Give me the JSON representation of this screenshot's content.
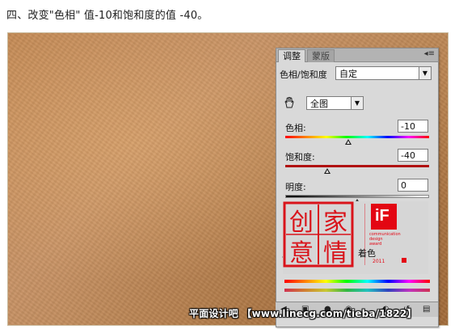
{
  "caption": "四、改变\"色相\" 值-10和饱和度的值 -40。",
  "panel": {
    "tabs": [
      {
        "label": "调整",
        "active": true
      },
      {
        "label": "蒙版",
        "active": false
      }
    ],
    "menu_icon": "panel-menu-icon",
    "title": "色相/饱和度",
    "preset": "自定",
    "channel": "全图",
    "hue_label": "色相:",
    "hue_value": "-10",
    "saturation_label": "饱和度:",
    "saturation_value": "-40",
    "lightness_label": "明度:",
    "lightness_value": "0",
    "colorize_label": "着色",
    "hand_icon": "hand-tool-icon",
    "eyedropper_icon": "eyedropper-icon",
    "bottom_icons": [
      "back-arrow-icon",
      "expand-icon",
      "visibility-icon",
      "eye-icon",
      "clip-icon",
      "reset-icon",
      "delete-icon"
    ],
    "colors": {
      "panel": "#d9d9d9",
      "saturation_bar": "#b01010",
      "if_red": "#e30613"
    }
  },
  "seal": {
    "chars": [
      "创",
      "意",
      "家",
      "情"
    ]
  },
  "if_award": {
    "logo_text": "iF",
    "lines": [
      "communication",
      "design",
      "award"
    ],
    "year": "2011"
  },
  "watermark": "平面设计吧 【www.linecg.com/tieba/1822】"
}
